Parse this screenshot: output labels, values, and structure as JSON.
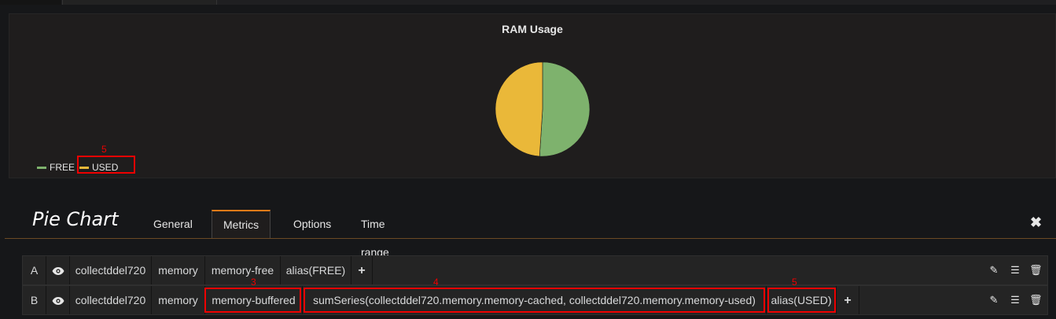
{
  "panel": {
    "title": "RAM Usage"
  },
  "chart_data": {
    "type": "pie",
    "title": "RAM Usage",
    "slices": [
      {
        "name": "FREE",
        "value": 0.51,
        "color": "#7eb26d"
      },
      {
        "name": "USED",
        "value": 0.49,
        "color": "#eab839"
      }
    ]
  },
  "legend": {
    "items": [
      {
        "label": "FREE",
        "color": "#7eb26d"
      },
      {
        "label": "USED",
        "color": "#eab839"
      }
    ]
  },
  "editor": {
    "title": "Pie Chart",
    "tabs": [
      "General",
      "Metrics",
      "Options",
      "Time range"
    ],
    "active_tab": "Metrics",
    "accent_color": "#eb7b18"
  },
  "queries": [
    {
      "ref": "A",
      "segments": [
        "collectddel720",
        "memory",
        "memory-free"
      ],
      "functions": [
        "alias(FREE)"
      ]
    },
    {
      "ref": "B",
      "segments": [
        "collectddel720",
        "memory",
        "memory-buffered"
      ],
      "functions": [
        "sumSeries(collectddel720.memory.memory-cached, collectddel720.memory.memory-used)",
        "alias(USED)"
      ]
    }
  ],
  "annotations": {
    "legend_used": "5",
    "segment_buffered": "3",
    "function_sum": "4",
    "function_alias_used": "5",
    "color": "#e00000"
  },
  "icons": {
    "eye": "eye-icon",
    "plus": "plus-icon",
    "pencil": "pencil-icon",
    "menu": "hamburger-menu-icon",
    "trash": "trash-icon",
    "close": "close-icon"
  }
}
